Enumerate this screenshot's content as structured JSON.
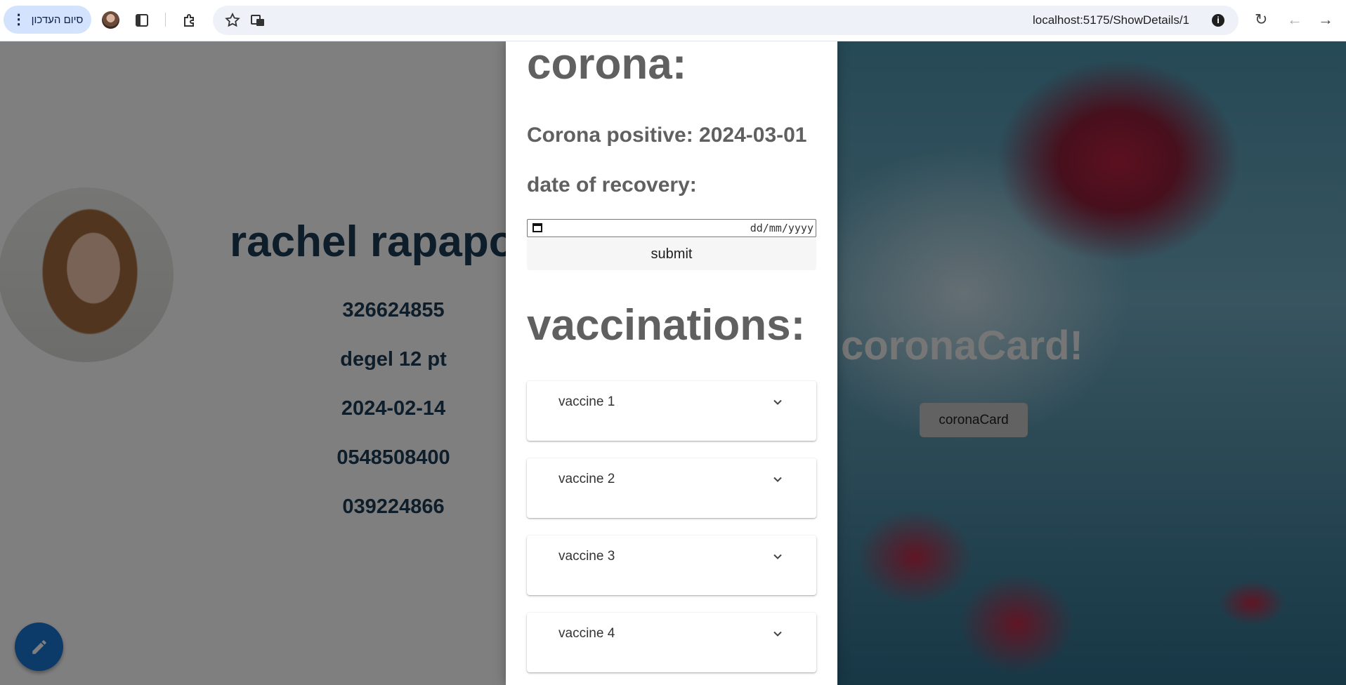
{
  "browser": {
    "update_button_label": "סיום העדכון",
    "url": "localhost:5175/ShowDetails/1"
  },
  "profile": {
    "name": "rachel rapapo",
    "details": [
      "326624855",
      "degel 12 pt",
      "2024-02-14",
      "0548508400",
      "039224866"
    ]
  },
  "corona_card": {
    "title": "coronaCard!",
    "button_label": "coronaCard"
  },
  "drawer": {
    "corona_heading": "corona:",
    "positive_text": "Corona positive: 2024-03-01",
    "recovery_label": "date of recovery:",
    "date_placeholder": "dd/mm/yyyy",
    "submit_label": "submit",
    "vaccinations_heading": "vaccinations:",
    "vaccines": [
      "vaccine 1",
      "vaccine 2",
      "vaccine 3",
      "vaccine 4"
    ]
  },
  "icons": {
    "fab": "pencil-icon",
    "accordion": "chevron-down-icon"
  },
  "colors": {
    "fab": "#1976d2",
    "heading_gray": "#606060",
    "name_blue": "#1a3a54"
  }
}
